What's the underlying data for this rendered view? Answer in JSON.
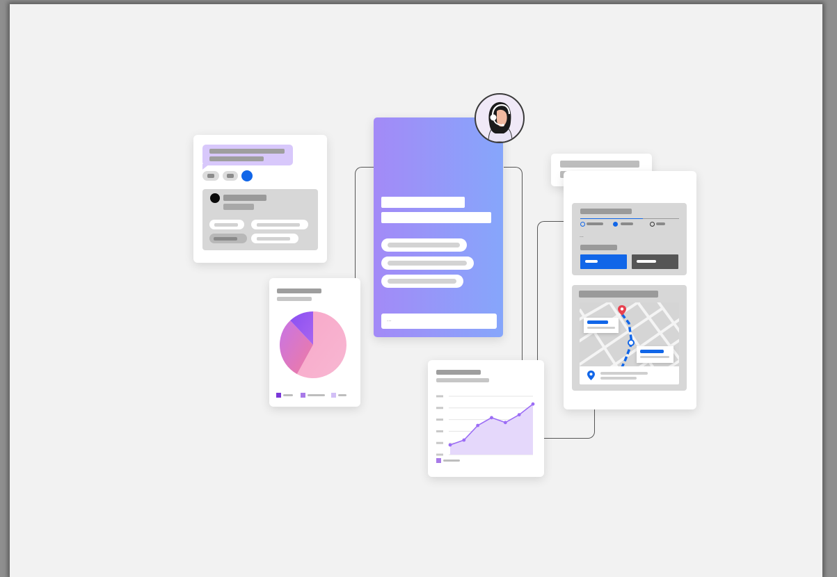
{
  "illustration": {
    "agent_avatar_icon": "headset-agent-avatar-icon",
    "input_placeholder": "...",
    "stepper_separator": "..."
  },
  "colors": {
    "background": "#f2f2f2",
    "card": "#ffffff",
    "placeholder_dark": "#9e9e9e",
    "placeholder_light": "#cfcfcf",
    "accent_blue": "#1166e8",
    "dark_button": "#555555",
    "purple": "#9b6cf5",
    "lavender": "#c9b3f8",
    "pink": "#f9a8c9",
    "map_pin_red": "#e8404f",
    "gradient_start": "#a38af7",
    "gradient_end": "#86a6fb"
  },
  "chart_data": [
    {
      "type": "pie",
      "values": [
        58,
        30,
        12
      ],
      "colors": [
        "#f9a8c9",
        "#c774e6",
        "#8a4ff2"
      ]
    },
    {
      "type": "area",
      "x": [
        1,
        2,
        3,
        4,
        5,
        6,
        7
      ],
      "series": [
        {
          "values": [
            1.0,
            1.5,
            3.0,
            3.8,
            3.3,
            4.1,
            5.2
          ]
        }
      ],
      "ylim": [
        0,
        6
      ],
      "grid": true,
      "legend": "bottom-left"
    }
  ]
}
